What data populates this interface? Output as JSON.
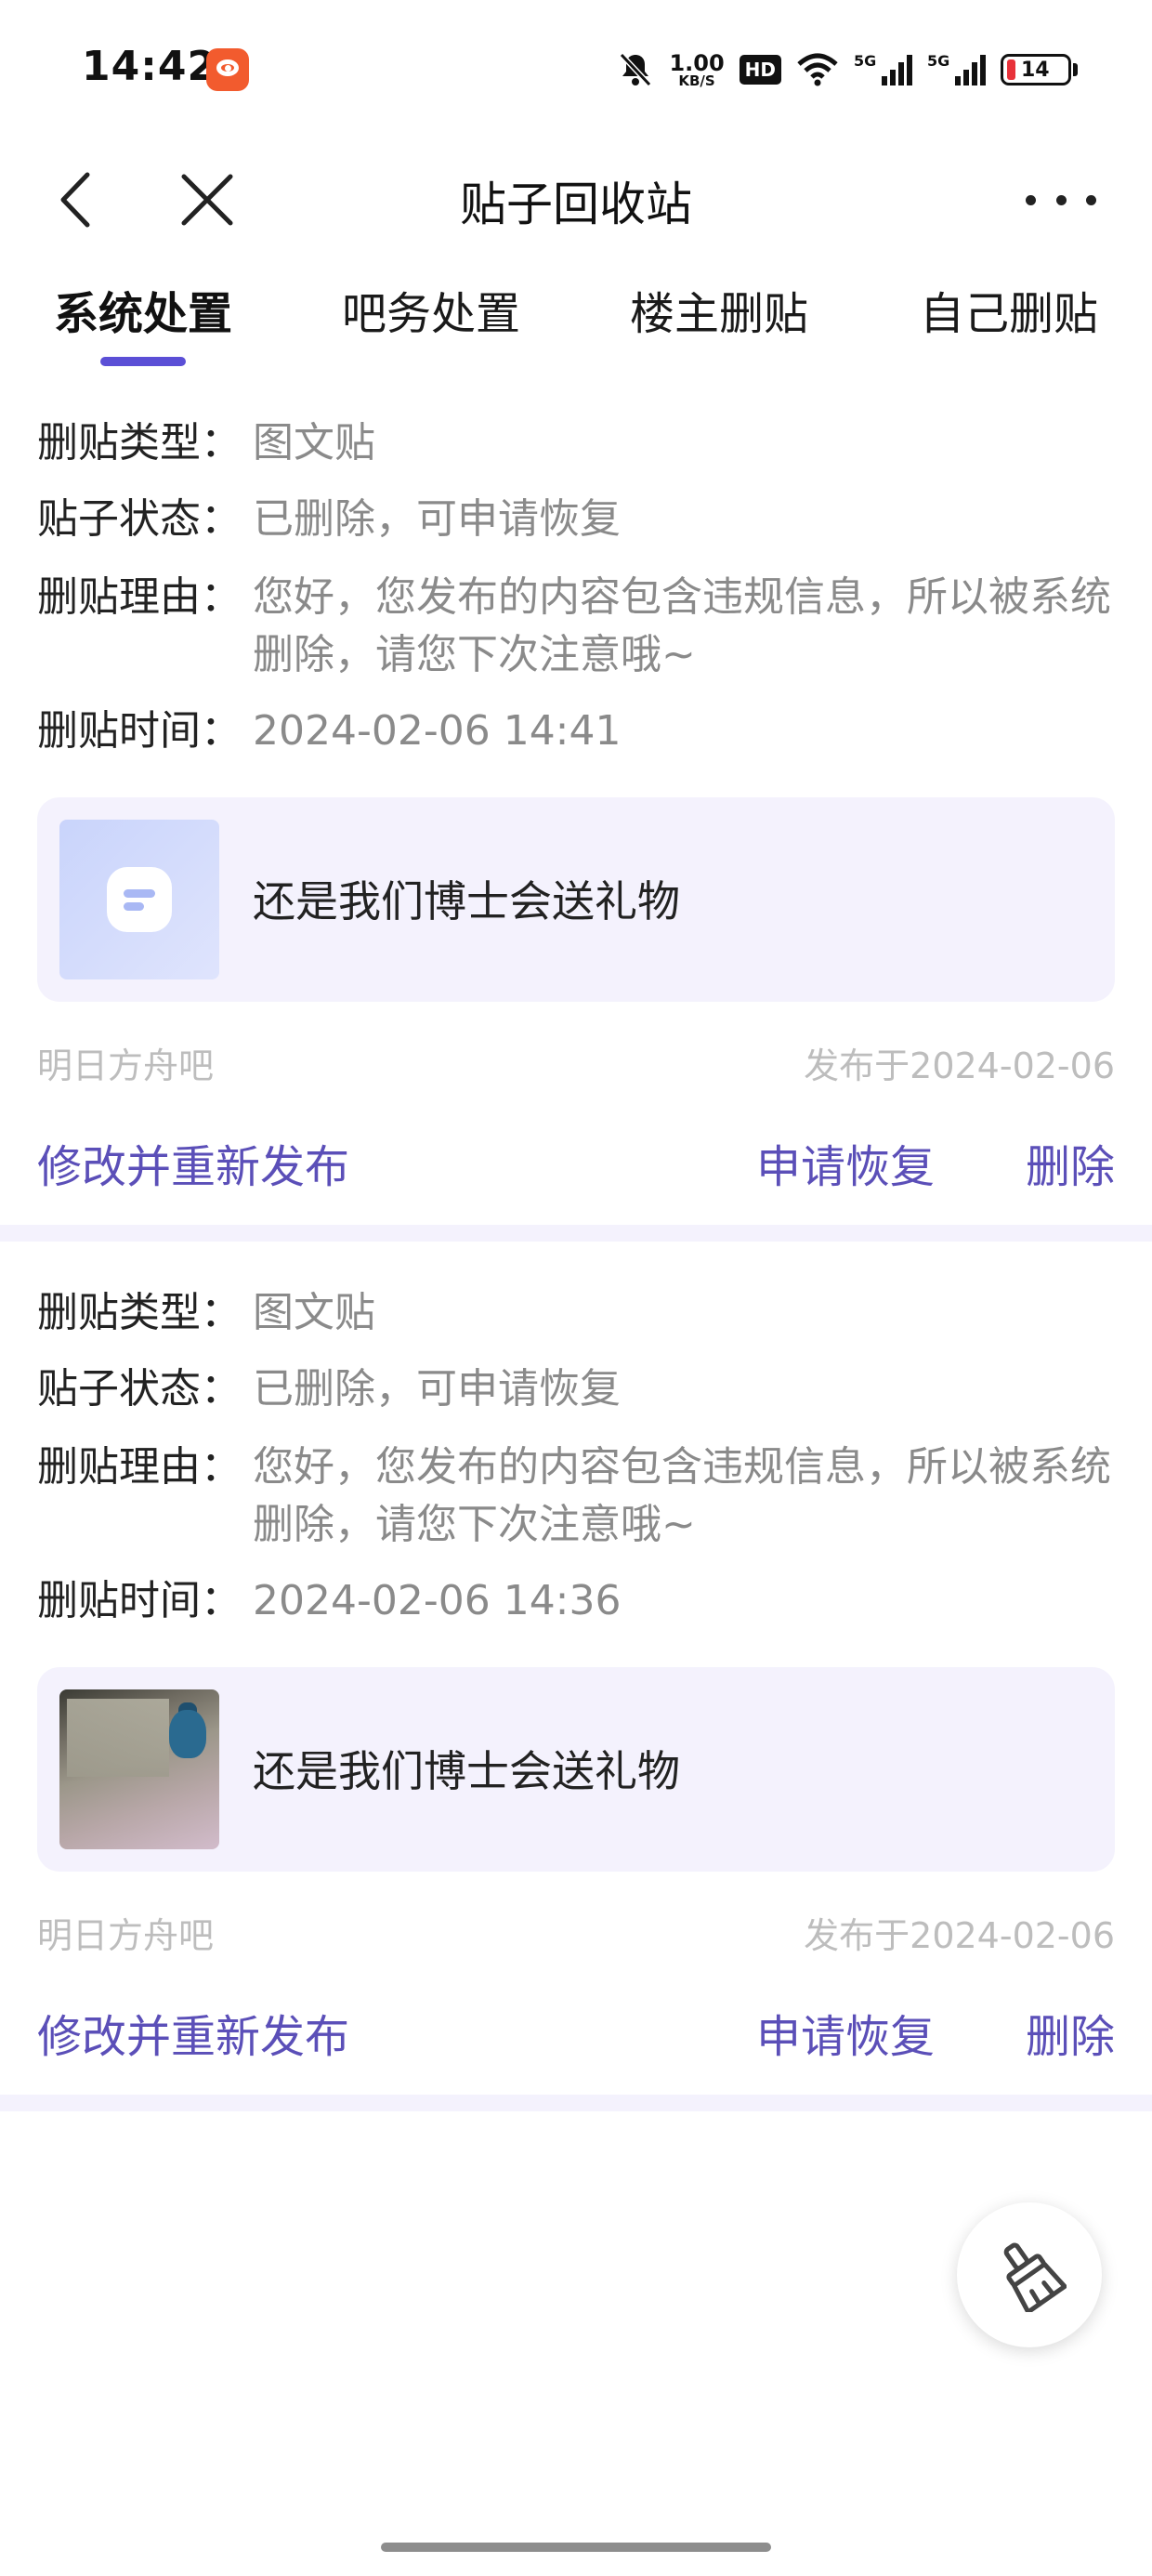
{
  "status_bar": {
    "time": "14:42",
    "net_speed_value": "1.00",
    "net_speed_unit": "KB/S",
    "hd_label": "HD",
    "signal_1_label": "5G",
    "signal_2_label": "5G",
    "battery_level": "14",
    "icons": [
      "weibo-app-icon",
      "mute-bell-icon",
      "wifi-icon",
      "signal-icon",
      "battery-icon"
    ]
  },
  "navbar": {
    "title": "贴子回收站",
    "back_icon": "chevron-left-icon",
    "close_icon": "close-icon",
    "more_icon": "more-dots-icon"
  },
  "tabs": [
    {
      "label": "系统处置",
      "active": true
    },
    {
      "label": "吧务处置",
      "active": false
    },
    {
      "label": "楼主删贴",
      "active": false
    },
    {
      "label": "自己删贴",
      "active": false
    }
  ],
  "posts": [
    {
      "type_key": "删贴类型：",
      "type_value": "图文贴",
      "status_key": "贴子状态：",
      "status_value": "已删除，可申请恢复",
      "reason_key": "删贴理由：",
      "reason_value": "您好，您发布的内容包含违规信息，所以被系统删除，请您下次注意哦~",
      "time_key": "删贴时间：",
      "time_value": "2024-02-06 14:41",
      "thumb_title": "还是我们博士会送礼物",
      "forum": "明日方舟吧",
      "published": "发布于2024-02-06",
      "action_edit": "修改并重新发布",
      "action_restore": "申请恢复",
      "action_delete": "删除"
    },
    {
      "type_key": "删贴类型：",
      "type_value": "图文贴",
      "status_key": "贴子状态：",
      "status_value": "已删除，可申请恢复",
      "reason_key": "删贴理由：",
      "reason_value": "您好，您发布的内容包含违规信息，所以被系统删除，请您下次注意哦~",
      "time_key": "删贴时间：",
      "time_value": "2024-02-06 14:36",
      "thumb_title": "还是我们博士会送礼物",
      "forum": "明日方舟吧",
      "published": "发布于2024-02-06",
      "action_edit": "修改并重新发布",
      "action_restore": "申请恢复",
      "action_delete": "删除"
    }
  ],
  "fab": {
    "icon": "broom-icon"
  },
  "colors": {
    "accent": "#5b4fd6",
    "action_text": "#5b4fb8",
    "card_bg": "#f4f2fd",
    "muted_text": "#8a8a8a",
    "meta_text": "#bdbdbd"
  }
}
